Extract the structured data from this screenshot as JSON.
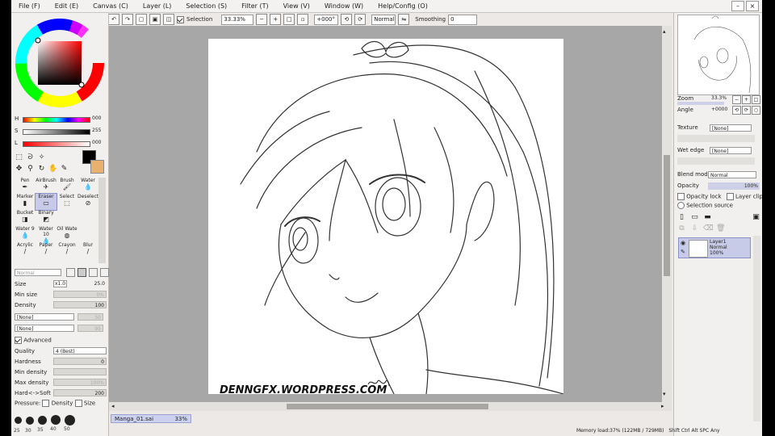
{
  "menu": [
    "File (F)",
    "Edit (E)",
    "Canvas (C)",
    "Layer (L)",
    "Selection (S)",
    "Filter (T)",
    "View (V)",
    "Window (W)",
    "Help/Config (O)"
  ],
  "toolbar": {
    "selection_label": "Selection",
    "zoom": "33.33%",
    "rotation": "+000°",
    "blend": "Normal",
    "smoothing_label": "Smoothing",
    "smoothing_value": "0"
  },
  "color": {
    "foreground": "#000000",
    "background": "#e8b16e",
    "hue_wheel": "#ff0000",
    "sliders": [
      {
        "label": "H",
        "value": "000",
        "gradient": "rainbow"
      },
      {
        "label": "S",
        "value": "255",
        "gradient": "#ffffff-#000000"
      },
      {
        "label": "L",
        "value": "000",
        "gradient": "#ff0000-#ffffff"
      }
    ]
  },
  "tools": [
    {
      "label": "Pen",
      "icon": "pen-icon"
    },
    {
      "label": "AirBrush",
      "icon": "airbrush-icon"
    },
    {
      "label": "Brush",
      "icon": "brush-icon"
    },
    {
      "label": "Water",
      "icon": "water-icon"
    },
    {
      "label": "Marker",
      "icon": "marker-icon"
    },
    {
      "label": "Eraser",
      "icon": "eraser-icon"
    },
    {
      "label": "Select",
      "icon": "select-icon"
    },
    {
      "label": "Deselect",
      "icon": "deselect-icon"
    },
    {
      "label": "Bucket",
      "icon": "bucket-icon"
    },
    {
      "label": "Binary",
      "icon": "binary-icon"
    },
    {
      "label": "",
      "icon": ""
    },
    {
      "label": "",
      "icon": ""
    },
    {
      "label": "Water 9",
      "icon": "water-icon"
    },
    {
      "label": "Water 10",
      "icon": "water-icon"
    },
    {
      "label": "Oil Wate",
      "icon": "oil-water-icon"
    },
    {
      "label": "",
      "icon": ""
    },
    {
      "label": "Acrylic",
      "icon": "acrylic-icon"
    },
    {
      "label": "Paper",
      "icon": "paper-icon"
    },
    {
      "label": "Crayon",
      "icon": "crayon-icon"
    },
    {
      "label": "Blur",
      "icon": "blur-icon"
    }
  ],
  "brush_props": {
    "mode": "Normal",
    "size_label": "Size",
    "size_mult": "x1.0",
    "size_value": "25.0",
    "min_size_label": "Min size",
    "min_size_value": "0%",
    "density_label": "Density",
    "density_value": "100",
    "shape1": "[None]",
    "shape1_value": "50",
    "shape2": "[None]",
    "shape2_value": "95",
    "advanced_label": "Advanced",
    "quality_label": "Quality",
    "quality_value": "4 (Best)",
    "hardness_label": "Hardness",
    "hardness_value": "0",
    "min_density_label": "Min density",
    "min_density_value": "",
    "max_density_label": "Max density",
    "max_density_value": "100%",
    "hs_label": "Hard<->Soft",
    "hs_value": "200",
    "pressure_label": "Pressure:",
    "pressure_density": "Density",
    "pressure_size": "Size"
  },
  "brush_sizes": [
    "25",
    "30",
    "35",
    "40",
    "50"
  ],
  "canvas": {
    "watermark": "DENNGFX.WORDPRESS.COM"
  },
  "document_tab": {
    "name": "Manga_01.sai",
    "zoom": "33%"
  },
  "navigator": {
    "zoom_label": "Zoom",
    "zoom_value": "33.3%",
    "angle_label": "Angle",
    "angle_value": "+0000"
  },
  "layer_panel": {
    "texture_label": "Texture",
    "texture_value": "[None]",
    "wet_edge_label": "Wet edge",
    "wet_edge_value": "[None]",
    "blend_mode_label": "Blend mode",
    "blend_mode_value": "Normal",
    "opacity_label": "Opacity",
    "opacity_value": "100%",
    "protect_opacity_label": "Opacity lock",
    "layer_clip_label": "Layer clip",
    "selection_source_label": "Selection source"
  },
  "layers": [
    {
      "name": "Layer1",
      "mode": "Normal",
      "opacity": "100%"
    }
  ],
  "status": {
    "memory": "Memory load:37% (122MB / 729MB)",
    "keys": [
      "Shift",
      "Ctrl",
      "Alt",
      "SPC",
      "Any"
    ]
  }
}
